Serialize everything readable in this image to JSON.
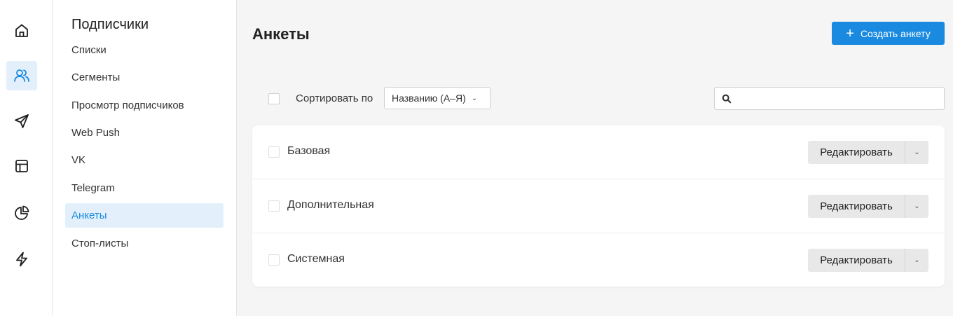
{
  "rail": {
    "items": [
      {
        "icon": "home-icon",
        "active": false
      },
      {
        "icon": "subscribers-icon",
        "active": true
      },
      {
        "icon": "send-icon",
        "active": false
      },
      {
        "icon": "layout-icon",
        "active": false
      },
      {
        "icon": "pie-chart-icon",
        "active": false
      },
      {
        "icon": "lightning-icon",
        "active": false
      }
    ]
  },
  "subnav": {
    "title": "Подписчики",
    "items": [
      {
        "label": "Списки"
      },
      {
        "label": "Сегменты"
      },
      {
        "label": "Просмотр подписчиков"
      },
      {
        "label": "Web Push"
      },
      {
        "label": "VK"
      },
      {
        "label": "Telegram"
      },
      {
        "label": "Анкеты",
        "active": true
      },
      {
        "label": "Стоп-листы"
      }
    ]
  },
  "page": {
    "title": "Анкеты",
    "create_button": {
      "icon": "plus-icon",
      "label": "Создать анкету"
    }
  },
  "toolbar": {
    "sort_label": "Сортировать по",
    "sort_value": "Названию (А–Я)",
    "search_placeholder": "",
    "search_value": ""
  },
  "forms": [
    {
      "name": "Базовая",
      "edit_label": "Редактировать"
    },
    {
      "name": "Дополнительная",
      "edit_label": "Редактировать"
    },
    {
      "name": "Системная",
      "edit_label": "Редактировать"
    }
  ],
  "colors": {
    "accent": "#1a8ae0",
    "active_bg": "#e3f0fb",
    "page_bg": "#f5f5f5"
  }
}
